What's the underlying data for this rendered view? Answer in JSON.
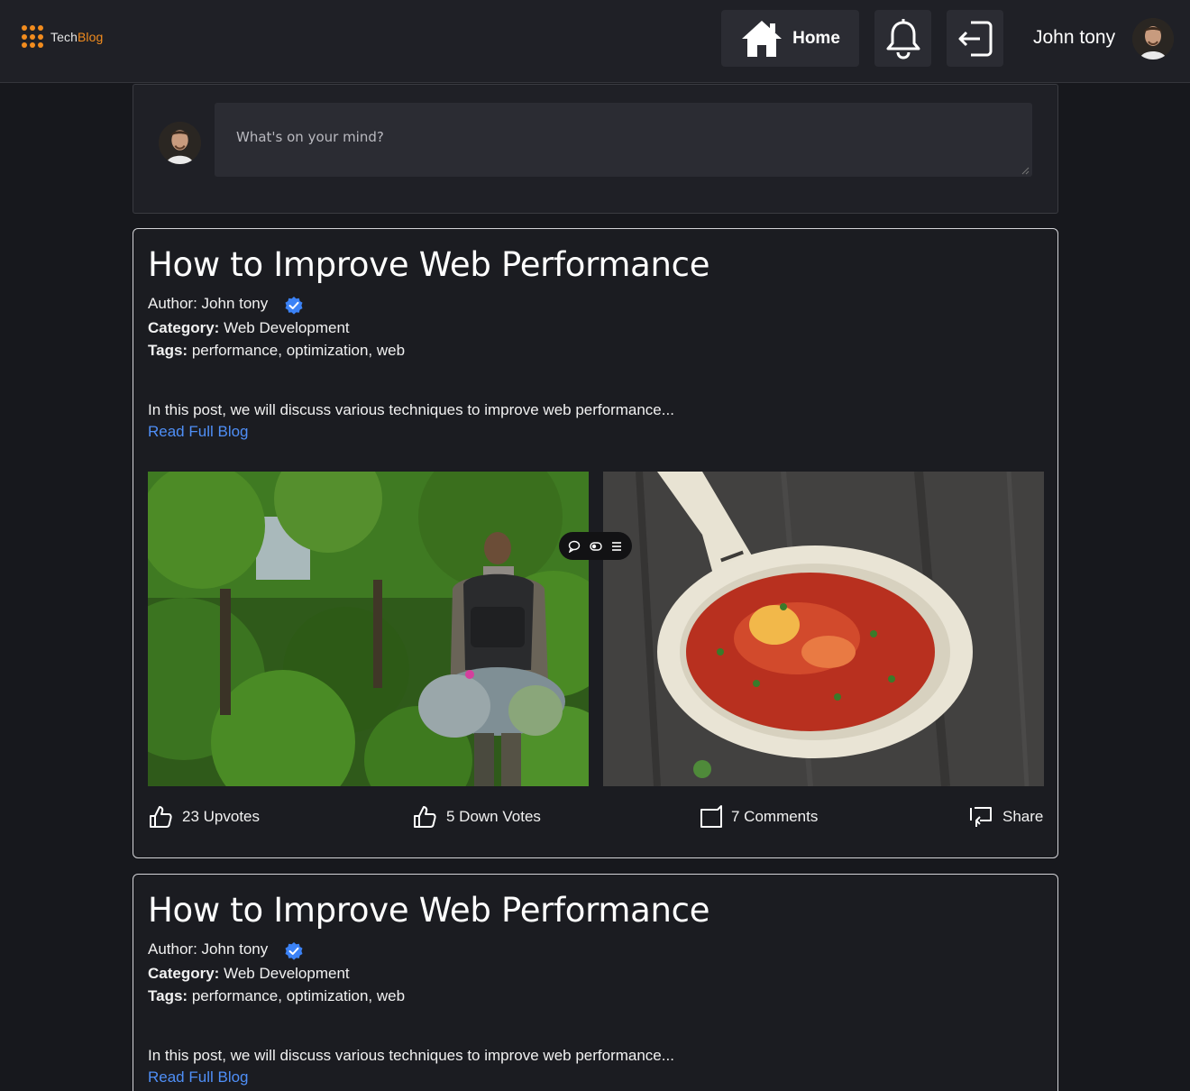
{
  "brand": {
    "name_part1": "Tech",
    "name_part2": "Blog",
    "logo_color": "#f28c1e"
  },
  "nav": {
    "home_label": "Home",
    "user_name": "John tony",
    "icons": [
      "home-icon",
      "bell-icon",
      "logout-icon"
    ]
  },
  "composer": {
    "placeholder": "What's on your mind?"
  },
  "posts": [
    {
      "title": "How to Improve Web Performance",
      "author": "Author: John tony",
      "category_label": "Category:",
      "category": "Web Development",
      "tags_label": "Tags:",
      "tags": "performance, optimization, web",
      "excerpt": "In this post, we will discuss various techniques to improve web performance...",
      "read_more": "Read Full Blog",
      "images": [
        "hiker-in-forest",
        "tomato-egg-pan"
      ],
      "upvotes": "23 Upvotes",
      "downvotes": "5 Down Votes",
      "comments": "7 Comments",
      "share": "Share"
    },
    {
      "title": "How to Improve Web Performance",
      "author": "Author: John tony",
      "category_label": "Category:",
      "category": "Web Development",
      "tags_label": "Tags:",
      "tags": "performance, optimization, web",
      "excerpt": "In this post, we will discuss various techniques to improve web performance...",
      "read_more": "Read Full Blog"
    }
  ],
  "colors": {
    "background": "#17181d",
    "header": "#1f2026",
    "link": "#4f8ff7",
    "verified": "#3b82f6"
  }
}
